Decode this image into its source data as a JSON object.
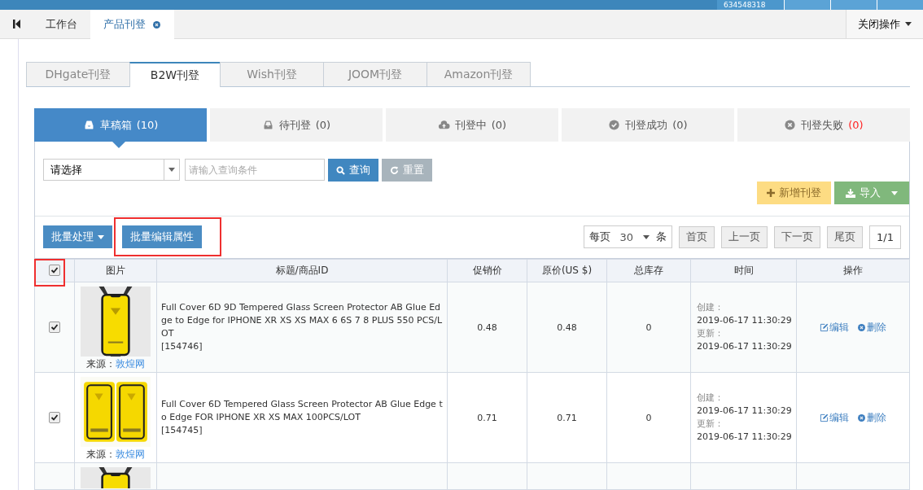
{
  "top_bar": {
    "account": "634548318"
  },
  "page_tabs": [
    {
      "label": "工作台",
      "selected": false,
      "closable": false
    },
    {
      "label": "产品刊登",
      "selected": true,
      "closable": true
    }
  ],
  "close_menu": "关闭操作",
  "platform_tabs": [
    {
      "label": "DHgate刊登",
      "selected": false
    },
    {
      "label": "B2W刊登",
      "selected": true
    },
    {
      "label": "Wish刊登",
      "selected": false
    },
    {
      "label": "JOOM刊登",
      "selected": false
    },
    {
      "label": "Amazon刊登",
      "selected": false
    }
  ],
  "status_tabs": [
    {
      "label": "草稿箱",
      "count": "(10)",
      "selected": true,
      "alert": false
    },
    {
      "label": "待刊登",
      "count": "(0)",
      "selected": false,
      "alert": false
    },
    {
      "label": "刊登中",
      "count": "(0)",
      "selected": false,
      "alert": false
    },
    {
      "label": "刊登成功",
      "count": "(0)",
      "selected": false,
      "alert": false
    },
    {
      "label": "刊登失败",
      "count": "(0)",
      "selected": false,
      "alert": true
    }
  ],
  "filter": {
    "select_value": "请选择",
    "placeholder": "请输入查询条件",
    "search": "查询",
    "reset": "重置"
  },
  "actions": {
    "add": "新增刊登",
    "import": "导入"
  },
  "batch": {
    "process": "批量处理",
    "edit": "批量编辑属性",
    "edit_highlighted": true
  },
  "pager": {
    "per_page": "每页",
    "size": "30",
    "unit": "条",
    "first": "首页",
    "prev": "上一页",
    "next": "下一页",
    "last": "尾页",
    "pages": "1/1"
  },
  "table": {
    "select_all": {
      "checked": true,
      "highlighted": true
    },
    "columns": [
      "图片",
      "标题/商品ID",
      "促销价",
      "原价(US $)",
      "总库存",
      "时间",
      "操作"
    ],
    "rows": [
      {
        "kind": "full",
        "checked": true,
        "source_label": "来源：",
        "source": "敦煌网",
        "title": "Full Cover 6D 9D Tempered Glass Screen Protector AB Glue Edge to Edge for IPHONE XR XS XS MAX 6 6S 7 8 PLUS 550 PCS/LOT",
        "id": "[154746]",
        "promo_price": "0.48",
        "price": "0.48",
        "stock": "0",
        "created_label": "创建：",
        "created": "2019-06-17 11:30:29",
        "updated_label": "更新：",
        "updated": "2019-06-17 11:30:29",
        "edit": "编辑",
        "delete": "删除"
      },
      {
        "kind": "full",
        "checked": true,
        "source_label": "来源：",
        "source": "敦煌网",
        "title": "Full Cover 6D Tempered Glass Screen Protector AB Glue Edge to Edge FOR IPHONE XR XS MAX 100PCS/LOT",
        "id": "[154745]",
        "promo_price": "0.71",
        "price": "0.71",
        "stock": "0",
        "created_label": "创建：",
        "created": "2019-06-17 11:30:29",
        "updated_label": "更新：",
        "updated": "2019-06-17 11:30:29",
        "edit": "编辑",
        "delete": "删除"
      },
      {
        "kind": "partial"
      }
    ]
  }
}
